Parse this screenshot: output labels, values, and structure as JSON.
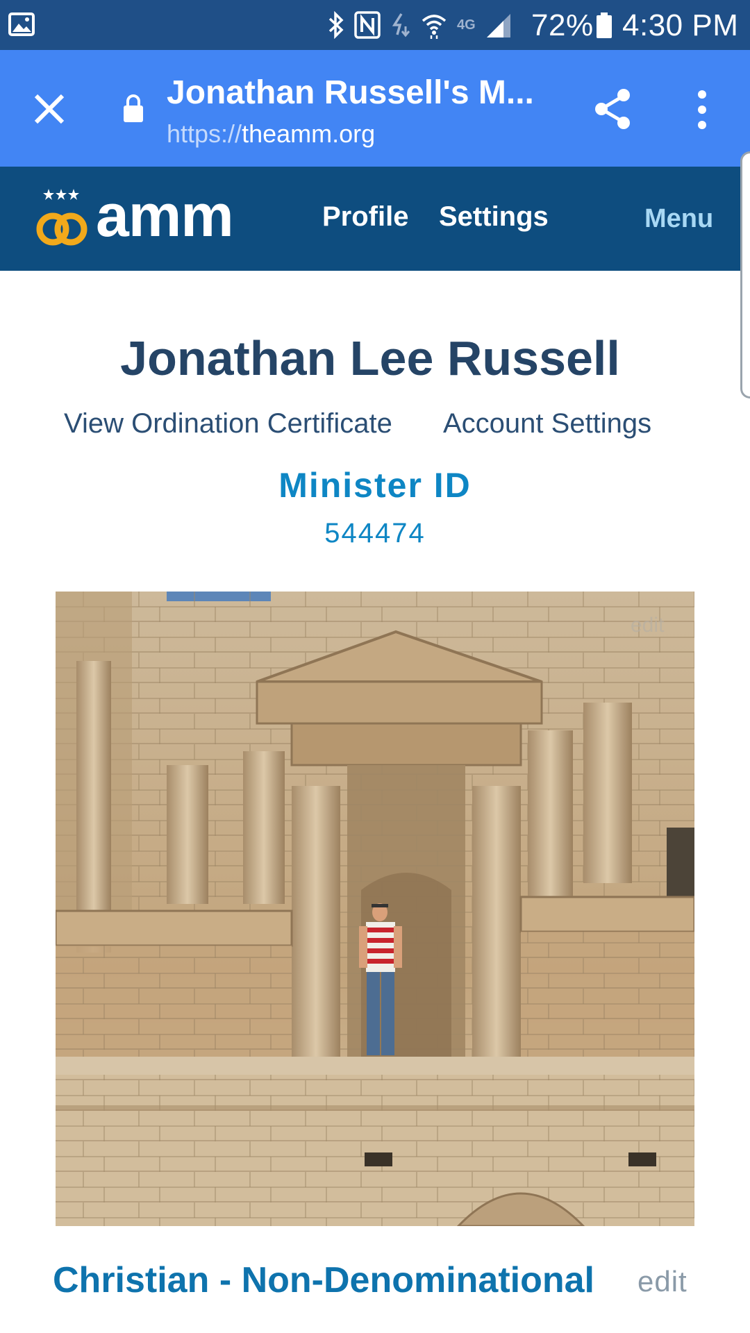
{
  "status_bar": {
    "battery_percent": "72%",
    "time": "4:30 PM",
    "network_label": "4G",
    "icons": [
      "gallery-icon",
      "bluetooth-icon",
      "nfc-icon",
      "data-transfer-icon",
      "wifi-icon",
      "signal-icon",
      "battery-icon"
    ]
  },
  "browser": {
    "page_title": "Jonathan Russell's M...",
    "url_scheme": "https://",
    "url_host": "theamm.org",
    "icons": [
      "close-icon",
      "lock-icon",
      "share-icon",
      "more-vert-icon"
    ]
  },
  "site_header": {
    "logo_text": "amm",
    "nav_profile": "Profile",
    "nav_settings": "Settings",
    "nav_menu": "Menu",
    "colors": {
      "header_bg": "#0e4d7f",
      "menu_text": "#a8d8f4",
      "logo_gold": "#f2a91b"
    }
  },
  "profile": {
    "full_name": "Jonathan Lee Russell",
    "link_certificate": "View Ordination Certificate",
    "link_account_settings": "Account Settings",
    "minister_id_label": "Minister ID",
    "minister_id_value": "544474",
    "photo_edit_label": "edit",
    "denomination": "Christian - Non-Denominational",
    "denomination_edit_label": "edit"
  }
}
